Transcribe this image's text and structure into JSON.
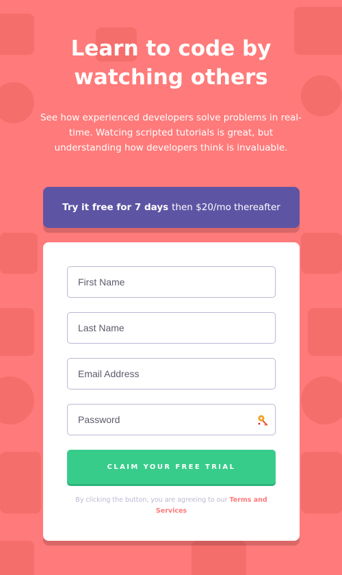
{
  "hero": {
    "title_line1": "Learn to code by",
    "title_line2": "watching others",
    "intro": "See how experienced developers solve problems in real-time. Watcing scripted tutorials is great, but understanding how developers think is invaluable."
  },
  "offer": {
    "bold": "Try it free for 7 days",
    "rest": "then $20/mo thereafter"
  },
  "form": {
    "first_name_placeholder": "First Name",
    "last_name_placeholder": "Last Name",
    "email_placeholder": "Email Address",
    "password_placeholder": "Password",
    "password_icon": "key-icon",
    "submit_label": "CLAIM YOUR FREE TRIAL",
    "terms_text": "By clicking the button, you are agreeing to our",
    "terms_link": "Terms and Services"
  },
  "colors": {
    "background": "#ff7a7a",
    "offer": "#5e54a4",
    "button": "#38cc8b",
    "terms_link": "#ff7a7a"
  }
}
